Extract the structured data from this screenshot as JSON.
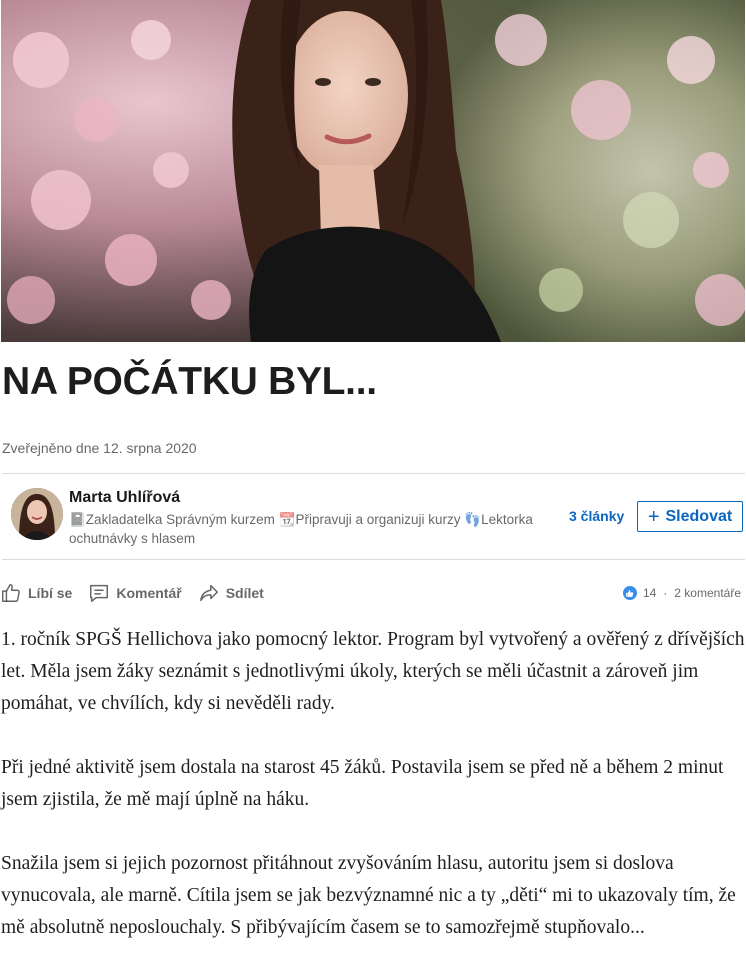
{
  "article": {
    "title": "NA POČÁTKU BYL...",
    "published": "Zveřejněno dne 12. srpna 2020",
    "paragraphs": [
      "1. ročník SPGŠ Hellichova jako pomocný lektor. Program byl vytvořený a ověřený z dřívějších let. Měla jsem žáky seznámit s jednotlivými úkoly, kterých se měli účastnit a zároveň jim pomáhat, ve chvílích, kdy si nevěděli rady.",
      "Při jedné aktivitě jsem dostala na starost 45 žáků. Postavila jsem se před ně a během 2 minut jsem zjistila, že mě mají úplně na háku.",
      "Snažila jsem si jejich pozornost přitáhnout zvyšováním hlasu, autoritu jsem si doslova vynucovala, ale marně. Cítila jsem se jak bezvýznamné nic a ty „děti“ mi to ukazovaly tím, že mě absolutně neposlouchaly. S přibývajícím časem se to samozřejmě stupňovalo..."
    ]
  },
  "author": {
    "name": "Marta Uhlířová",
    "headline": "📓Zakladatelka Správným kurzem 📆Připravuji a organizuji kurzy 👣Lektorka ochutnávky s hlasem",
    "articles_label": "3 články",
    "follow_label": "Sledovat"
  },
  "actions": {
    "like_label": "Líbí se",
    "comment_label": "Komentář",
    "share_label": "Sdílet"
  },
  "social": {
    "reactions": "14",
    "separator": "·",
    "comments": "2 komentáře"
  },
  "colors": {
    "accent": "#0a66c2",
    "like_badge": "#378fe9"
  },
  "icons": {
    "like": "thumbs-up-icon",
    "comment": "comment-icon",
    "share": "share-arrow-icon",
    "reaction_badge": "like-reaction-icon",
    "follow": "plus-icon"
  }
}
